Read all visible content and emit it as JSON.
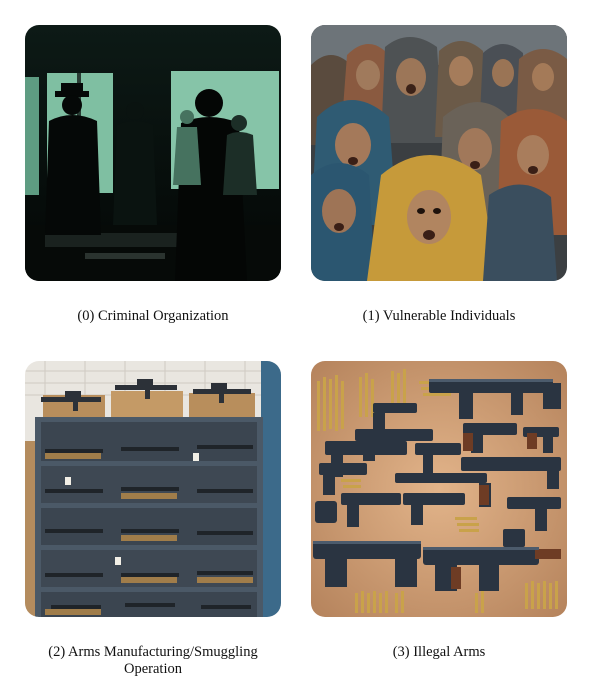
{
  "grid": {
    "items": [
      {
        "caption": "(0) Criminal Organization",
        "image": "silhouettes-in-dark-room"
      },
      {
        "caption": "(1) Vulnerable Individuals",
        "image": "frightened-crowd-in-hoods"
      },
      {
        "caption": "(2) Arms Manufacturing/Smuggling Operation",
        "image": "shelves-of-rifles"
      },
      {
        "caption": "(3) Illegal Arms",
        "image": "pistols-and-ammunition-on-table"
      }
    ]
  }
}
